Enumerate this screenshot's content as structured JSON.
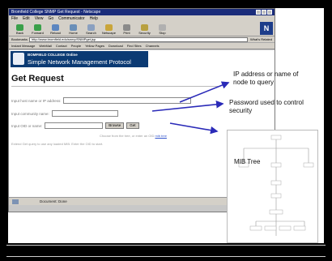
{
  "browser": {
    "title": "Bromfield College SNMP Get Request - Netscape",
    "menu": [
      "File",
      "Edit",
      "View",
      "Go",
      "Communicator",
      "Help"
    ],
    "toolbar": [
      "Back",
      "Forward",
      "Reload",
      "Home",
      "Search",
      "Netscape",
      "Print",
      "Security",
      "Stop"
    ],
    "location_label": "Bookmarks",
    "location_url": "http://www.bromfield.edu/snmp/SNMPget.jsp",
    "related_label": "What's Related",
    "bookmarks": [
      "Instant Message",
      "WebMail",
      "Contact",
      "People",
      "Yellow Pages",
      "Download",
      "Find Sites",
      "Channels"
    ],
    "status_text": "Document: Done"
  },
  "page": {
    "college": "BOMFIELD COLLEGE Online",
    "banner_title": "Simple Network Management Protocol",
    "heading": "Get Request",
    "host_label": "Input host name or IP address:",
    "community_label": "Input community name:",
    "oid_label": "Input OID or name:",
    "browse_button": "Browse",
    "get_button": "Get",
    "tree_hint": "Choose from the tree, or enter an OID",
    "tree_link": "mib tree",
    "footer_text": "Extend Get query to use any loaded MIB. Enter the OID to start."
  },
  "annotations": {
    "host_note": "IP address or name of node to query",
    "community_note": "Password used to control security",
    "mib_label": "MIB Tree"
  },
  "colors": {
    "titlebar": "#1a2c7a",
    "banner": "#0b3a73",
    "arrow": "#2a2ab8"
  }
}
